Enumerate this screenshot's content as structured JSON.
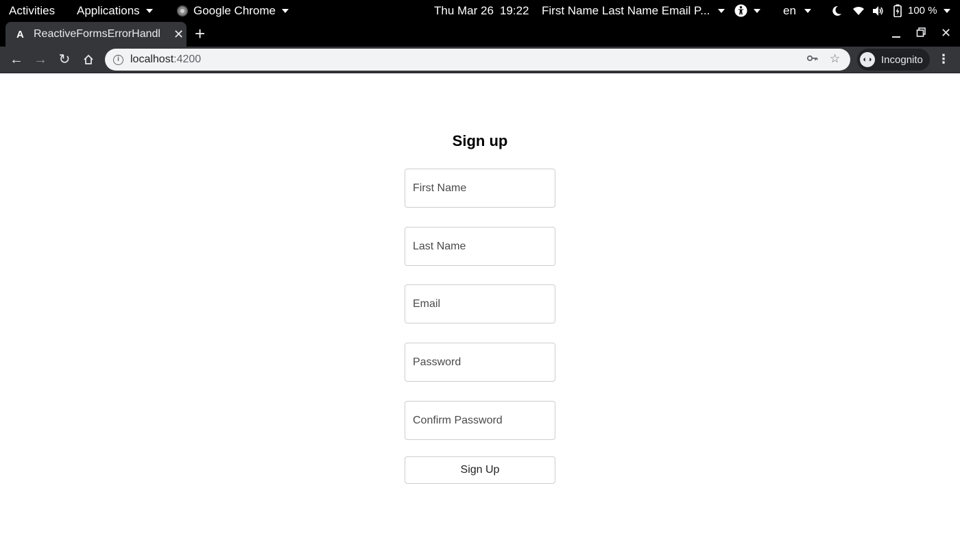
{
  "system_bar": {
    "activities": "Activities",
    "applications": "Applications",
    "app_name": "Google Chrome",
    "date": "Thu Mar 26",
    "time": "19:22",
    "window_title": "First Name Last Name Email P...",
    "language": "en",
    "battery": "100 %"
  },
  "browser": {
    "tab_title": "ReactiveFormsErrorHandl",
    "tab_favicon": "A",
    "url_host": "localhost",
    "url_port": ":4200",
    "profile_label": "Incognito"
  },
  "page": {
    "title": "Sign up",
    "fields": [
      {
        "placeholder": "First Name",
        "value": ""
      },
      {
        "placeholder": "Last Name",
        "value": ""
      },
      {
        "placeholder": "Email",
        "value": ""
      },
      {
        "placeholder": "Password",
        "value": ""
      },
      {
        "placeholder": "Confirm Password",
        "value": ""
      }
    ],
    "submit_label": "Sign Up"
  },
  "icons": {
    "accessibility": "accessibility-icon",
    "night_light": "moon-icon",
    "network": "wifi-icon",
    "volume": "volume-icon",
    "battery": "battery-icon",
    "key": "key-icon",
    "bookmark": "star-icon"
  },
  "colors": {
    "topbar": "#000000",
    "toolbar": "#35363a",
    "omnibox": "#f1f3f4",
    "field_border": "#cdcdcd"
  }
}
